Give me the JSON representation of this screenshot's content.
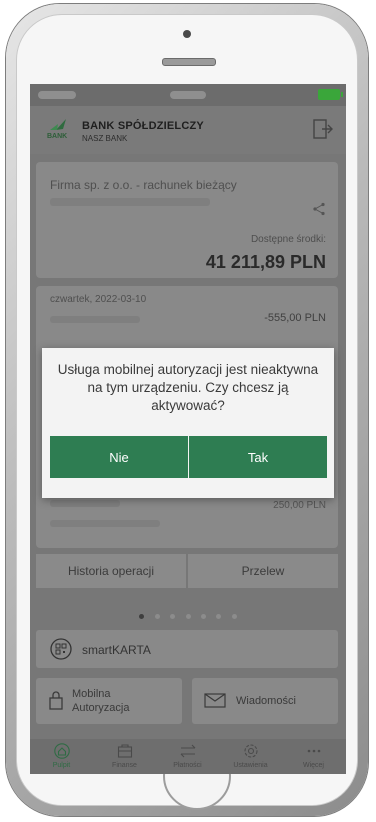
{
  "header": {
    "bank_name": "BANK SPÓŁDZIELCZY",
    "bank_subtitle": "NASZ BANK",
    "logo_text": "BANK"
  },
  "account": {
    "name": "Firma sp. z o.o. - rachunek bieżący",
    "available_label": "Dostępne środki:",
    "balance": "41 211,89 PLN"
  },
  "transactions": {
    "date": "czwartek, 2022-03-10",
    "amount": "-555,00 PLN",
    "row2_amount": "250,00 PLN"
  },
  "actions": {
    "history": "Historia operacji",
    "transfer": "Przelew"
  },
  "smartkarta": {
    "label": "smartKARTA"
  },
  "tiles": {
    "mobile_auth": "Mobilna Autoryzacja",
    "messages": "Wiadomości"
  },
  "tabbar": {
    "items": [
      {
        "label": "Pulpit",
        "icon": "home-icon",
        "active": true
      },
      {
        "label": "Finanse",
        "icon": "wallet-icon"
      },
      {
        "label": "Płatności",
        "icon": "transfer-arrows-icon"
      },
      {
        "label": "Ustawienia",
        "icon": "gear-icon"
      },
      {
        "label": "Więcej",
        "icon": "more-icon"
      }
    ]
  },
  "dialog": {
    "message": "Usługa mobilnej autoryzacji jest nieaktywna na tym urządzeniu. Czy chcesz ją aktywować?",
    "no_label": "Nie",
    "yes_label": "Tak"
  },
  "colors": {
    "brand_green": "#2e7d52",
    "overlay": "#777777"
  }
}
